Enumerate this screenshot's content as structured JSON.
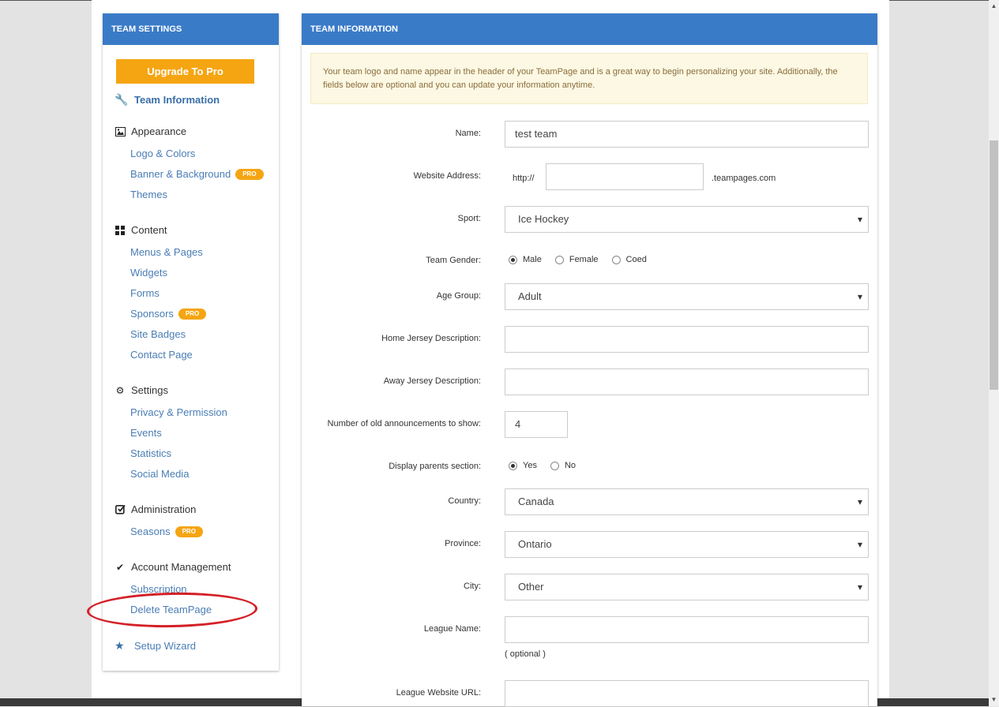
{
  "sidebar": {
    "header": "TEAM SETTINGS",
    "upgrade_label": "Upgrade To Pro",
    "team_information": "Team Information",
    "pro_badge": "PRO",
    "appearance": {
      "title": "Appearance",
      "items": [
        "Logo & Colors",
        "Banner & Background",
        "Themes"
      ]
    },
    "content": {
      "title": "Content",
      "items": [
        "Menus & Pages",
        "Widgets",
        "Forms",
        "Sponsors",
        "Site Badges",
        "Contact Page"
      ]
    },
    "settings": {
      "title": "Settings",
      "items": [
        "Privacy & Permission",
        "Events",
        "Statistics",
        "Social Media"
      ]
    },
    "administration": {
      "title": "Administration",
      "items": [
        "Seasons"
      ]
    },
    "account": {
      "title": "Account Management",
      "items": [
        "Subscription",
        "Delete TeamPage"
      ]
    },
    "setup_wizard": "Setup Wizard"
  },
  "main": {
    "header": "TEAM INFORMATION",
    "notice": "Your team logo and name appear in the header of your TeamPage and is a great way to begin personalizing your site. Additionally, the fields below are optional and you can update your information anytime.",
    "form": {
      "name_label": "Name:",
      "name_value": "test team",
      "website_label": "Website Address:",
      "website_prefix": "http://",
      "website_value": "",
      "website_suffix": ".teampages.com",
      "sport_label": "Sport:",
      "sport_value": "Ice Hockey",
      "gender_label": "Team Gender:",
      "gender_options": [
        "Male",
        "Female",
        "Coed"
      ],
      "age_label": "Age Group:",
      "age_value": "Adult",
      "home_jersey_label": "Home Jersey Description:",
      "home_jersey_value": "",
      "away_jersey_label": "Away Jersey Description:",
      "away_jersey_value": "",
      "announcements_label": "Number of old announcements to show:",
      "announcements_value": "4",
      "parents_label": "Display parents section:",
      "parents_options": [
        "Yes",
        "No"
      ],
      "country_label": "Country:",
      "country_value": "Canada",
      "province_label": "Province:",
      "province_value": "Ontario",
      "city_label": "City:",
      "city_value": "Other",
      "league_name_label": "League Name:",
      "league_name_value": "",
      "optional_hint": "( optional )",
      "league_url_label": "League Website URL:",
      "league_url_value": ""
    }
  },
  "colors": {
    "header_blue": "#3a7bc8",
    "pro_orange": "#f5a512",
    "annotation_red": "#d42027"
  }
}
